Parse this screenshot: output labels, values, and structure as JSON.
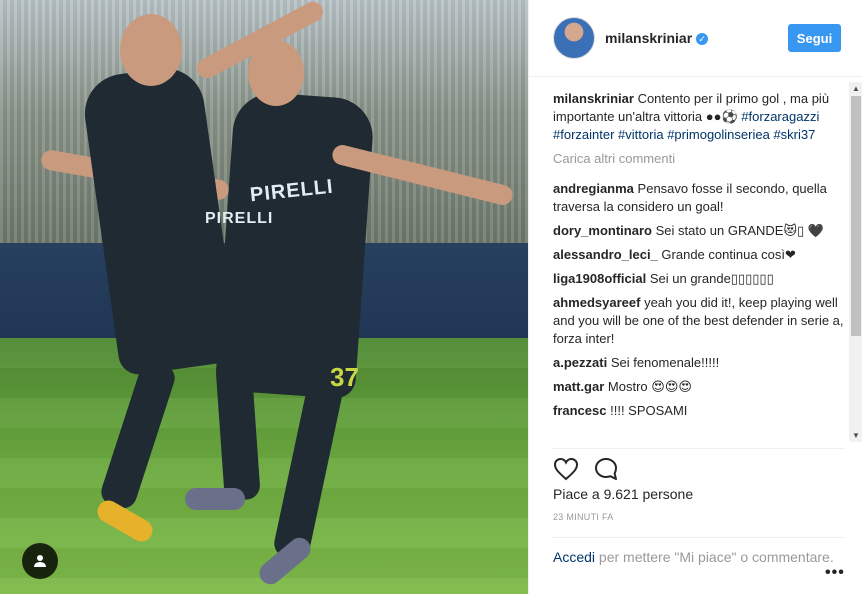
{
  "post": {
    "username": "milanskriniar",
    "follow_label": "Segui",
    "caption_text": "Contento per il primo gol , ma più importante un'altra vittoria ●●⚽",
    "hashtags": [
      "#forzaragazzi",
      "#forzainter",
      "#vittoria",
      "#primogolinseriea",
      "#skri37"
    ],
    "load_more_label": "Carica altri commenti"
  },
  "photo": {
    "shirt_text_1": "PIRELLI",
    "shirt_text_2": "PIRELLI",
    "shirt_number": "37"
  },
  "comments": [
    {
      "user": "andregianma",
      "text": "Pensavo fosse il secondo, quella traversa la considero un goal!"
    },
    {
      "user": "dory_montinaro",
      "text": "Sei stato un GRANDE😻▯ 🖤"
    },
    {
      "user": "alessandro_leci_",
      "text": "Grande continua così❤"
    },
    {
      "user": "liga1908official",
      "text": "Sei un grande▯▯▯▯▯▯"
    },
    {
      "user": "ahmedsyareef",
      "text": "yeah you did it!, keep playing well and you will be one of the best defender in serie a, forza inter!"
    },
    {
      "user": "a.pezzati",
      "text": "Sei fenomenale!!!!!"
    },
    {
      "user": "matt.gar",
      "text": "Mostro 😍😍😍"
    },
    {
      "user": "francesc",
      "text": "!!!! SPOSAMI"
    }
  ],
  "footer": {
    "likes_label": "Piace a 9.621 persone",
    "time_ago": "23 MINUTI FA",
    "login_link": "Accedi",
    "login_text": " per mettere \"Mi piace\" o commentare.",
    "more_label": "•••"
  },
  "icons": {
    "like": "heart-outline-icon",
    "comment": "speech-bubble-icon",
    "user_tag": "user-silhouette-icon",
    "verified": "verified-badge-icon"
  },
  "colors": {
    "accent": "#3897f0",
    "link": "#003569",
    "muted": "#999999"
  }
}
